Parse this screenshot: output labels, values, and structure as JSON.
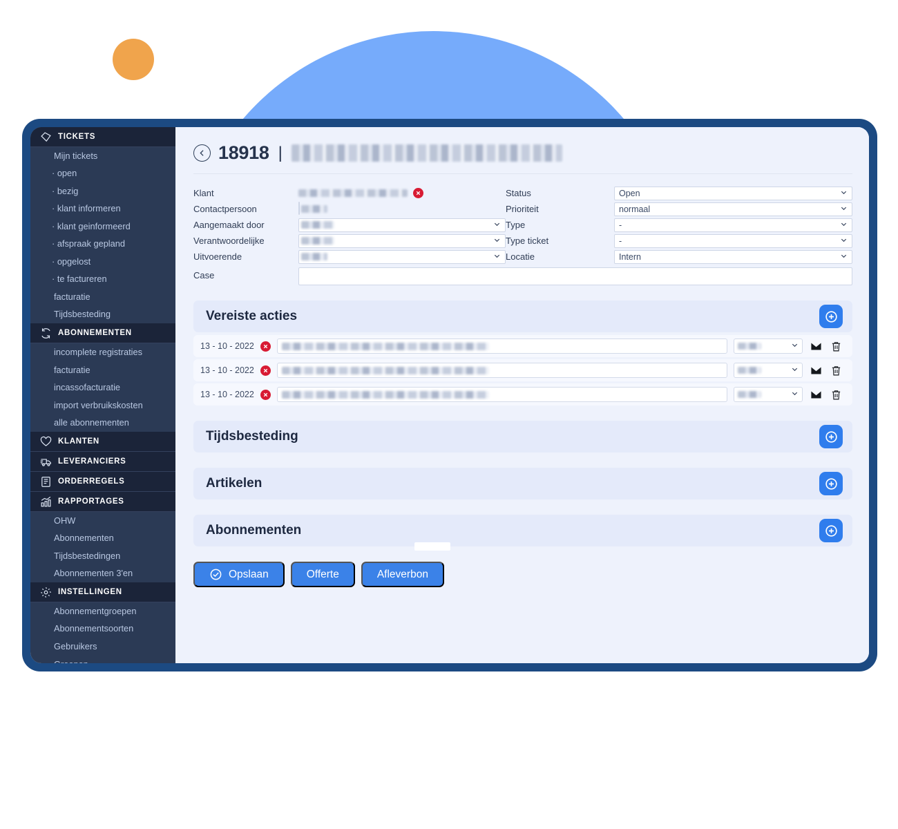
{
  "decor": {
    "blue_circle_color": "#76abfb",
    "orange_circle_color": "#f0a44c",
    "frame_color": "#1c4a82",
    "content_bg": "#eef2fc",
    "accent_blue": "#2f7ded",
    "error_red": "#d81b33"
  },
  "sidebar": {
    "groups": [
      {
        "label": "TICKETS",
        "icon": "ticket-tag-icon",
        "active": true,
        "items": [
          {
            "label": "Mijn tickets",
            "dotted": false
          },
          {
            "label": "· open",
            "dotted": true
          },
          {
            "label": "· bezig",
            "dotted": true
          },
          {
            "label": "· klant informeren",
            "dotted": true
          },
          {
            "label": "· klant geinformeerd",
            "dotted": true
          },
          {
            "label": "· afspraak gepland",
            "dotted": true
          },
          {
            "label": "· opgelost",
            "dotted": true
          },
          {
            "label": "· te factureren",
            "dotted": true
          },
          {
            "label": "facturatie",
            "dotted": false
          },
          {
            "label": "Tijdsbesteding",
            "dotted": false
          }
        ]
      },
      {
        "label": "ABONNEMENTEN",
        "icon": "refresh-cycle-icon",
        "items": [
          {
            "label": "incomplete registraties"
          },
          {
            "label": "facturatie"
          },
          {
            "label": "incassofacturatie"
          },
          {
            "label": "import verbruikskosten"
          },
          {
            "label": "alle abonnementen"
          }
        ]
      },
      {
        "label": "KLANTEN",
        "icon": "heart-icon",
        "items": []
      },
      {
        "label": "LEVERANCIERS",
        "icon": "truck-icon",
        "items": []
      },
      {
        "label": "ORDERREGELS",
        "icon": "document-list-icon",
        "items": []
      },
      {
        "label": "RAPPORTAGES",
        "icon": "bar-chart-icon",
        "items": [
          {
            "label": "OHW"
          },
          {
            "label": "Abonnementen"
          },
          {
            "label": "Tijdsbestedingen"
          },
          {
            "label": "Abonnementen 3'en"
          }
        ]
      },
      {
        "label": "INSTELLINGEN",
        "icon": "gear-icon",
        "items": [
          {
            "label": "Abonnementgroepen"
          },
          {
            "label": "Abonnementsoorten"
          },
          {
            "label": "Gebruikers"
          },
          {
            "label": "Groepen"
          }
        ]
      }
    ]
  },
  "header": {
    "ticket_number": "18918",
    "separator": "|",
    "customer_name_redacted": "",
    "back_icon": "back-chevron-icon"
  },
  "form": {
    "left": [
      {
        "label": "Klant",
        "type": "plain",
        "value": "",
        "has_error": true
      },
      {
        "label": "Contactpersoon",
        "type": "input",
        "value": ""
      },
      {
        "label": "Aangemaakt door",
        "type": "select",
        "value": ""
      },
      {
        "label": "Verantwoordelijke",
        "type": "select",
        "value": ""
      },
      {
        "label": "Uitvoerende",
        "type": "select",
        "value": ""
      }
    ],
    "right": [
      {
        "label": "Status",
        "type": "select",
        "value": "Open"
      },
      {
        "label": "Prioriteit",
        "type": "select",
        "value": "normaal"
      },
      {
        "label": "Type",
        "type": "select",
        "value": "-"
      },
      {
        "label": "Type ticket",
        "type": "select",
        "value": "-"
      },
      {
        "label": "Locatie",
        "type": "select",
        "value": "Intern"
      }
    ],
    "case": {
      "label": "Case",
      "value": ""
    }
  },
  "panels": [
    {
      "title": "Vereiste acties",
      "add_label": "+",
      "rows": [
        {
          "date": "13 - 10 - 2022",
          "text": "",
          "select": "",
          "mail_icon": "envelope-icon",
          "delete_icon": "trash-icon"
        },
        {
          "date": "13 - 10 - 2022",
          "text": "",
          "select": "",
          "mail_icon": "envelope-icon",
          "delete_icon": "trash-icon"
        },
        {
          "date": "13 - 10 - 2022",
          "text": "",
          "select": "",
          "mail_icon": "envelope-icon",
          "delete_icon": "trash-icon"
        }
      ]
    },
    {
      "title": "Tijdsbesteding",
      "rows": []
    },
    {
      "title": "Artikelen",
      "rows": []
    },
    {
      "title": "Abonnementen",
      "rows": []
    }
  ],
  "footer": {
    "buttons": [
      {
        "label": "Opslaan",
        "icon": "check-circle-icon"
      },
      {
        "label": "Offerte",
        "icon": null
      },
      {
        "label": "Afleverbon",
        "icon": null
      }
    ]
  }
}
